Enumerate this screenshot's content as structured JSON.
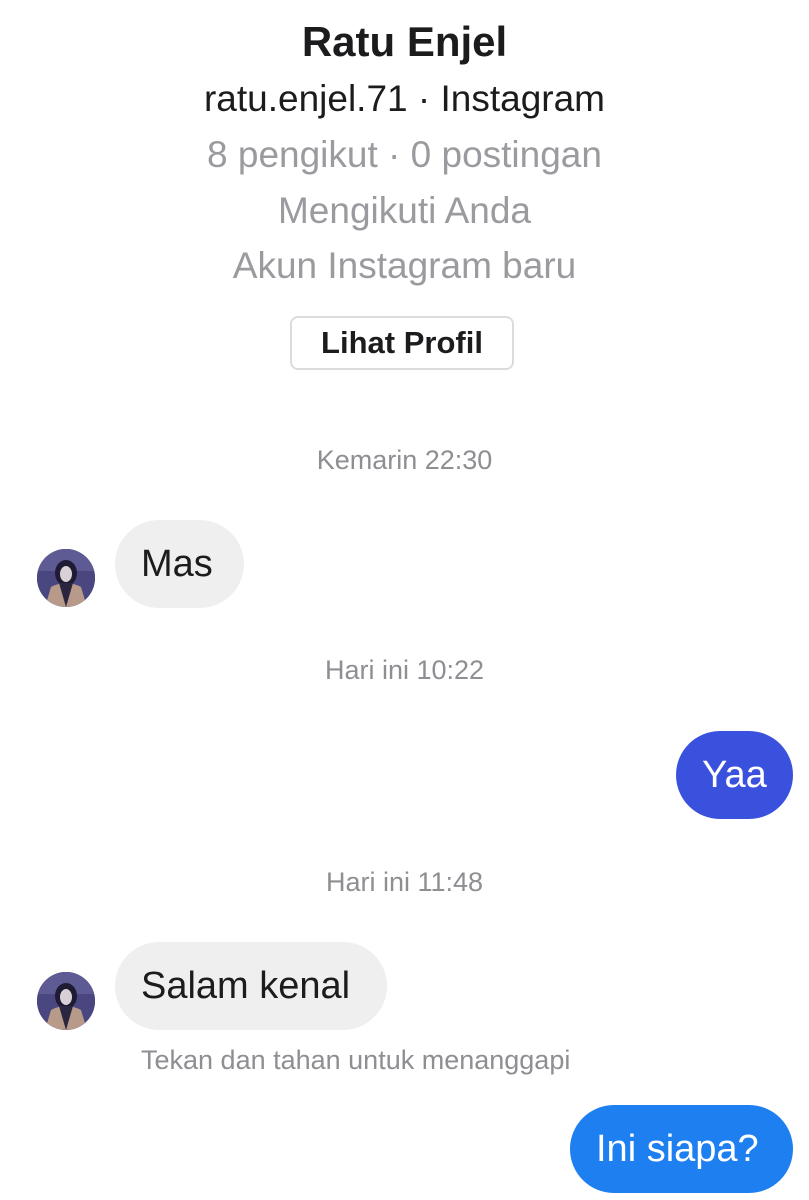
{
  "profile": {
    "name": "Ratu Enjel",
    "handle_line": "ratu.enjel.71 · Instagram",
    "stats_line": "8 pengikut · 0 postingan",
    "follows_line": "Mengikuti Anda",
    "account_line": "Akun Instagram baru",
    "view_profile_label": "Lihat Profil"
  },
  "conversation": {
    "timestamps": [
      "Kemarin 22:30",
      "Hari ini 10:22",
      "Hari ini 11:48"
    ],
    "messages": [
      {
        "sender": "them",
        "text": "Mas"
      },
      {
        "sender": "me",
        "text": "Yaa"
      },
      {
        "sender": "them",
        "text": "Salam kenal"
      },
      {
        "sender": "me",
        "text": "Ini siapa?"
      }
    ],
    "reply_hint": "Tekan dan tahan untuk menanggapi"
  },
  "colors": {
    "outgoing_bubble_1": "#3a51de",
    "outgoing_bubble_2": "#1d7ff0",
    "incoming_bubble": "#efefef",
    "muted_text": "#8e8e93"
  }
}
